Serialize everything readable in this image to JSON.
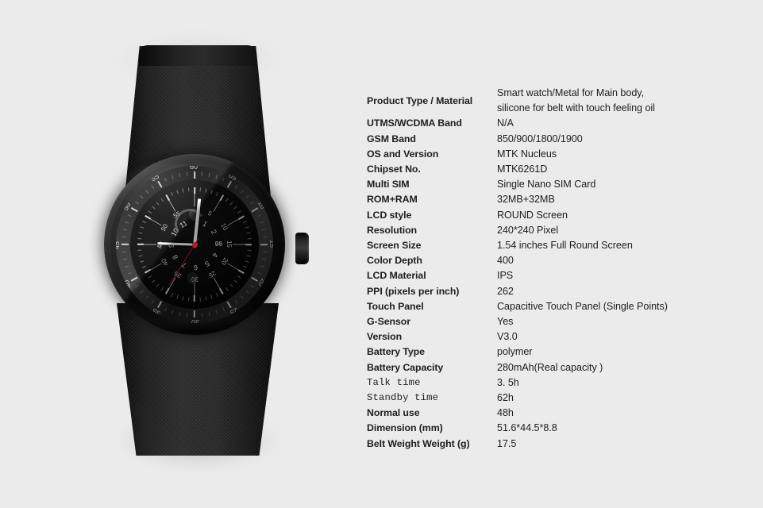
{
  "page": {
    "background_color": "#ebebeb"
  },
  "product_image": {
    "alt_name": "smart-watch-front-view",
    "watch": {
      "case_color": "#1a1a1a",
      "strap_color": "#151515",
      "second_hand_color": "#a8202c",
      "hand_color": "#fdfdfd",
      "bezel_numerals": [
        "60",
        "05",
        "10",
        "15",
        "20",
        "25",
        "30",
        "35",
        "40",
        "45",
        "50",
        "55"
      ],
      "dial_numerals": [
        "10",
        "15",
        "20",
        "25",
        "30",
        "35",
        "40",
        "45",
        "50",
        "55",
        "5"
      ],
      "hour_markers": [
        "1",
        "2",
        "3",
        "4",
        "5",
        "6",
        "7",
        "8",
        "9",
        "10",
        "11",
        "12"
      ],
      "date_display": "29",
      "time_display": "9:01"
    }
  },
  "spec_table": {
    "rows": [
      {
        "label": "Product Type / Material",
        "value": "Smart watch/Metal for Main body, silicone for belt with touch feeling oil",
        "value_line1": "Smart watch/Metal for Main body,",
        "value_line2": "silicone for belt with touch feeling oil",
        "multiline": true,
        "label_style": "bold"
      },
      {
        "label": "UTMS/WCDMA Band",
        "value": "N/A",
        "label_style": "bold"
      },
      {
        "label": "GSM Band",
        "value": "850/900/1800/1900",
        "label_style": "bold"
      },
      {
        "label": "OS and Version",
        "value": "MTK Nucleus",
        "label_style": "bold"
      },
      {
        "label": "Chipset No.",
        "value": "MTK6261D",
        "label_style": "bold"
      },
      {
        "label": "Multi SIM",
        "value": "Single Nano SIM Card",
        "label_style": "bold"
      },
      {
        "label": "ROM+RAM",
        "value": "32MB+32MB",
        "label_style": "bold"
      },
      {
        "label": "LCD style",
        "value": "ROUND Screen",
        "label_style": "bold"
      },
      {
        "label": "Resolution",
        "value": "240*240 Pixel",
        "label_style": "bold"
      },
      {
        "label": "Screen Size",
        "value": "1.54 inches Full Round Screen",
        "label_style": "bold"
      },
      {
        "label": "Color Depth",
        "value": "400",
        "label_style": "bold"
      },
      {
        "label": "LCD Material",
        "value": "IPS",
        "label_style": "bold"
      },
      {
        "label": "PPI (pixels per inch)",
        "value": "262",
        "label_style": "bold"
      },
      {
        "label": "Touch Panel",
        "value": "Capacitive Touch Panel (Single Points)",
        "label_style": "bold"
      },
      {
        "label": "G-Sensor",
        "value": "Yes",
        "label_style": "bold"
      },
      {
        "label": "Version",
        "value": "V3.0",
        "label_style": "bold"
      },
      {
        "label": "Battery Type",
        "value": "polymer",
        "label_style": "bold"
      },
      {
        "label": "Battery Capacity",
        "value": "280mAh(Real capacity )",
        "label_style": "bold"
      },
      {
        "label": "Talk time",
        "value": "3. 5h",
        "label_style": "mono"
      },
      {
        "label": "Standby time",
        "value": "62h",
        "label_style": "mono"
      },
      {
        "label": "Normal use",
        "value": "48h",
        "label_style": "bold"
      },
      {
        "label": "Dimension (mm)",
        "value": "51.6*44.5*8.8",
        "label_style": "bold"
      },
      {
        "label": "Belt Weight  Weight (g)",
        "value": "17.5",
        "label_style": "bold"
      }
    ]
  }
}
